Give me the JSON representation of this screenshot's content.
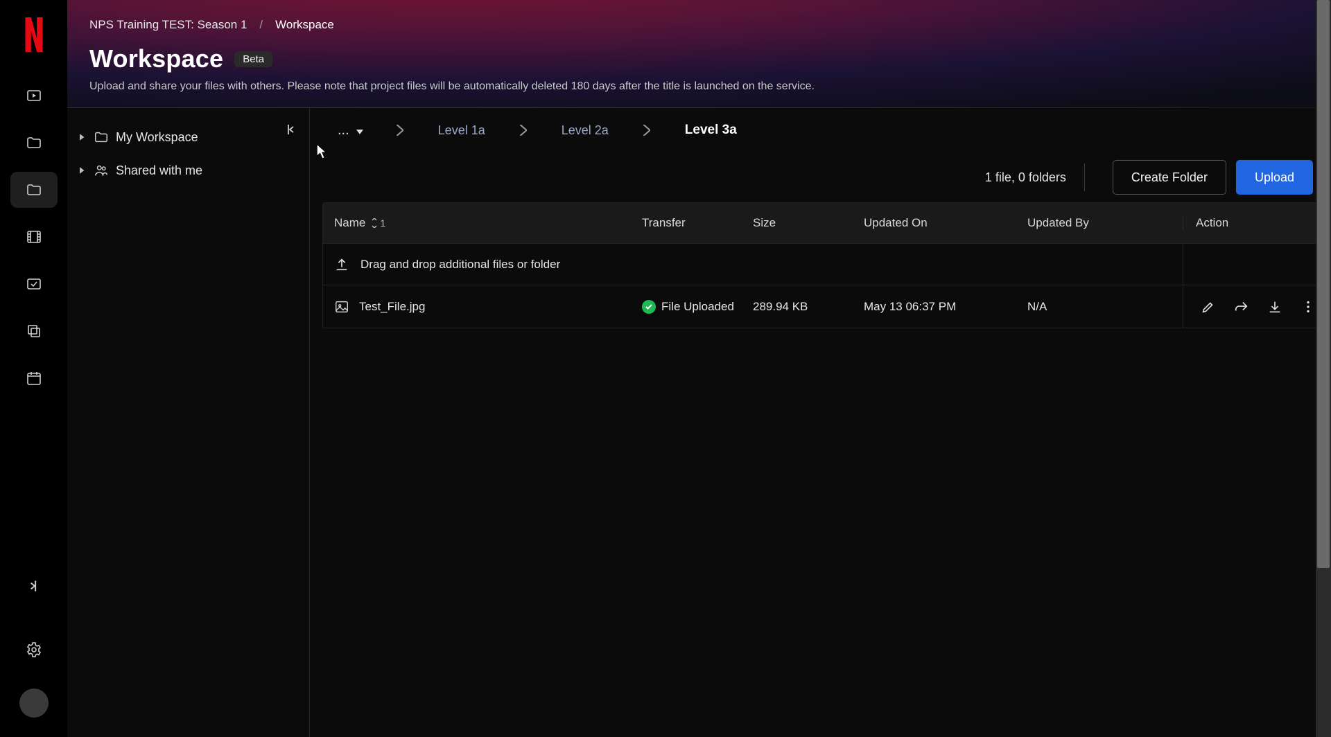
{
  "sidebar": {
    "logo_alt": "N",
    "items": [
      {
        "name": "videos",
        "icon": "play-icon"
      },
      {
        "name": "folder-a",
        "icon": "folder-icon"
      },
      {
        "name": "workspace",
        "icon": "folder-icon",
        "active": true
      },
      {
        "name": "film",
        "icon": "film-icon"
      },
      {
        "name": "sync",
        "icon": "sync-icon"
      },
      {
        "name": "slides",
        "icon": "slides-icon"
      },
      {
        "name": "calendar",
        "icon": "calendar-icon"
      }
    ],
    "collapse_alt": "Collapse sidebar",
    "settings_alt": "Settings"
  },
  "header": {
    "crumb_project": "NPS Training TEST: Season 1",
    "crumb_sep": "/",
    "crumb_section": "Workspace",
    "title": "Workspace",
    "badge": "Beta",
    "subtitle": "Upload and share your files with others. Please note that project files will be automatically deleted 180 days after the title is launched on the service."
  },
  "tree": {
    "items": [
      {
        "label": "My Workspace",
        "icon": "folder-icon",
        "expand": true
      },
      {
        "label": "Shared with me",
        "icon": "people-icon",
        "expand": true
      }
    ],
    "collapse_alt": "Collapse tree"
  },
  "breadcrumb": {
    "ellipsis": "...",
    "items": [
      {
        "label": "Level 1a",
        "current": false
      },
      {
        "label": "Level 2a",
        "current": false
      },
      {
        "label": "Level 3a",
        "current": true
      }
    ]
  },
  "toolbar": {
    "count_label": "1 file, 0 folders",
    "create_folder_label": "Create Folder",
    "upload_label": "Upload"
  },
  "table": {
    "columns": {
      "name": "Name",
      "transfer": "Transfer",
      "size": "Size",
      "updated_on": "Updated On",
      "updated_by": "Updated By",
      "action": "Action"
    },
    "sort_index": "1",
    "drop_hint": "Drag and drop additional files or folder",
    "rows": [
      {
        "name": "Test_File.jpg",
        "transfer_status": "File Uploaded",
        "size": "289.94 KB",
        "updated_on": "May 13 06:37 PM",
        "updated_by": "N/A"
      }
    ]
  },
  "colors": {
    "accent": "#2265e0",
    "success": "#1db954",
    "logo": "#e50914"
  }
}
